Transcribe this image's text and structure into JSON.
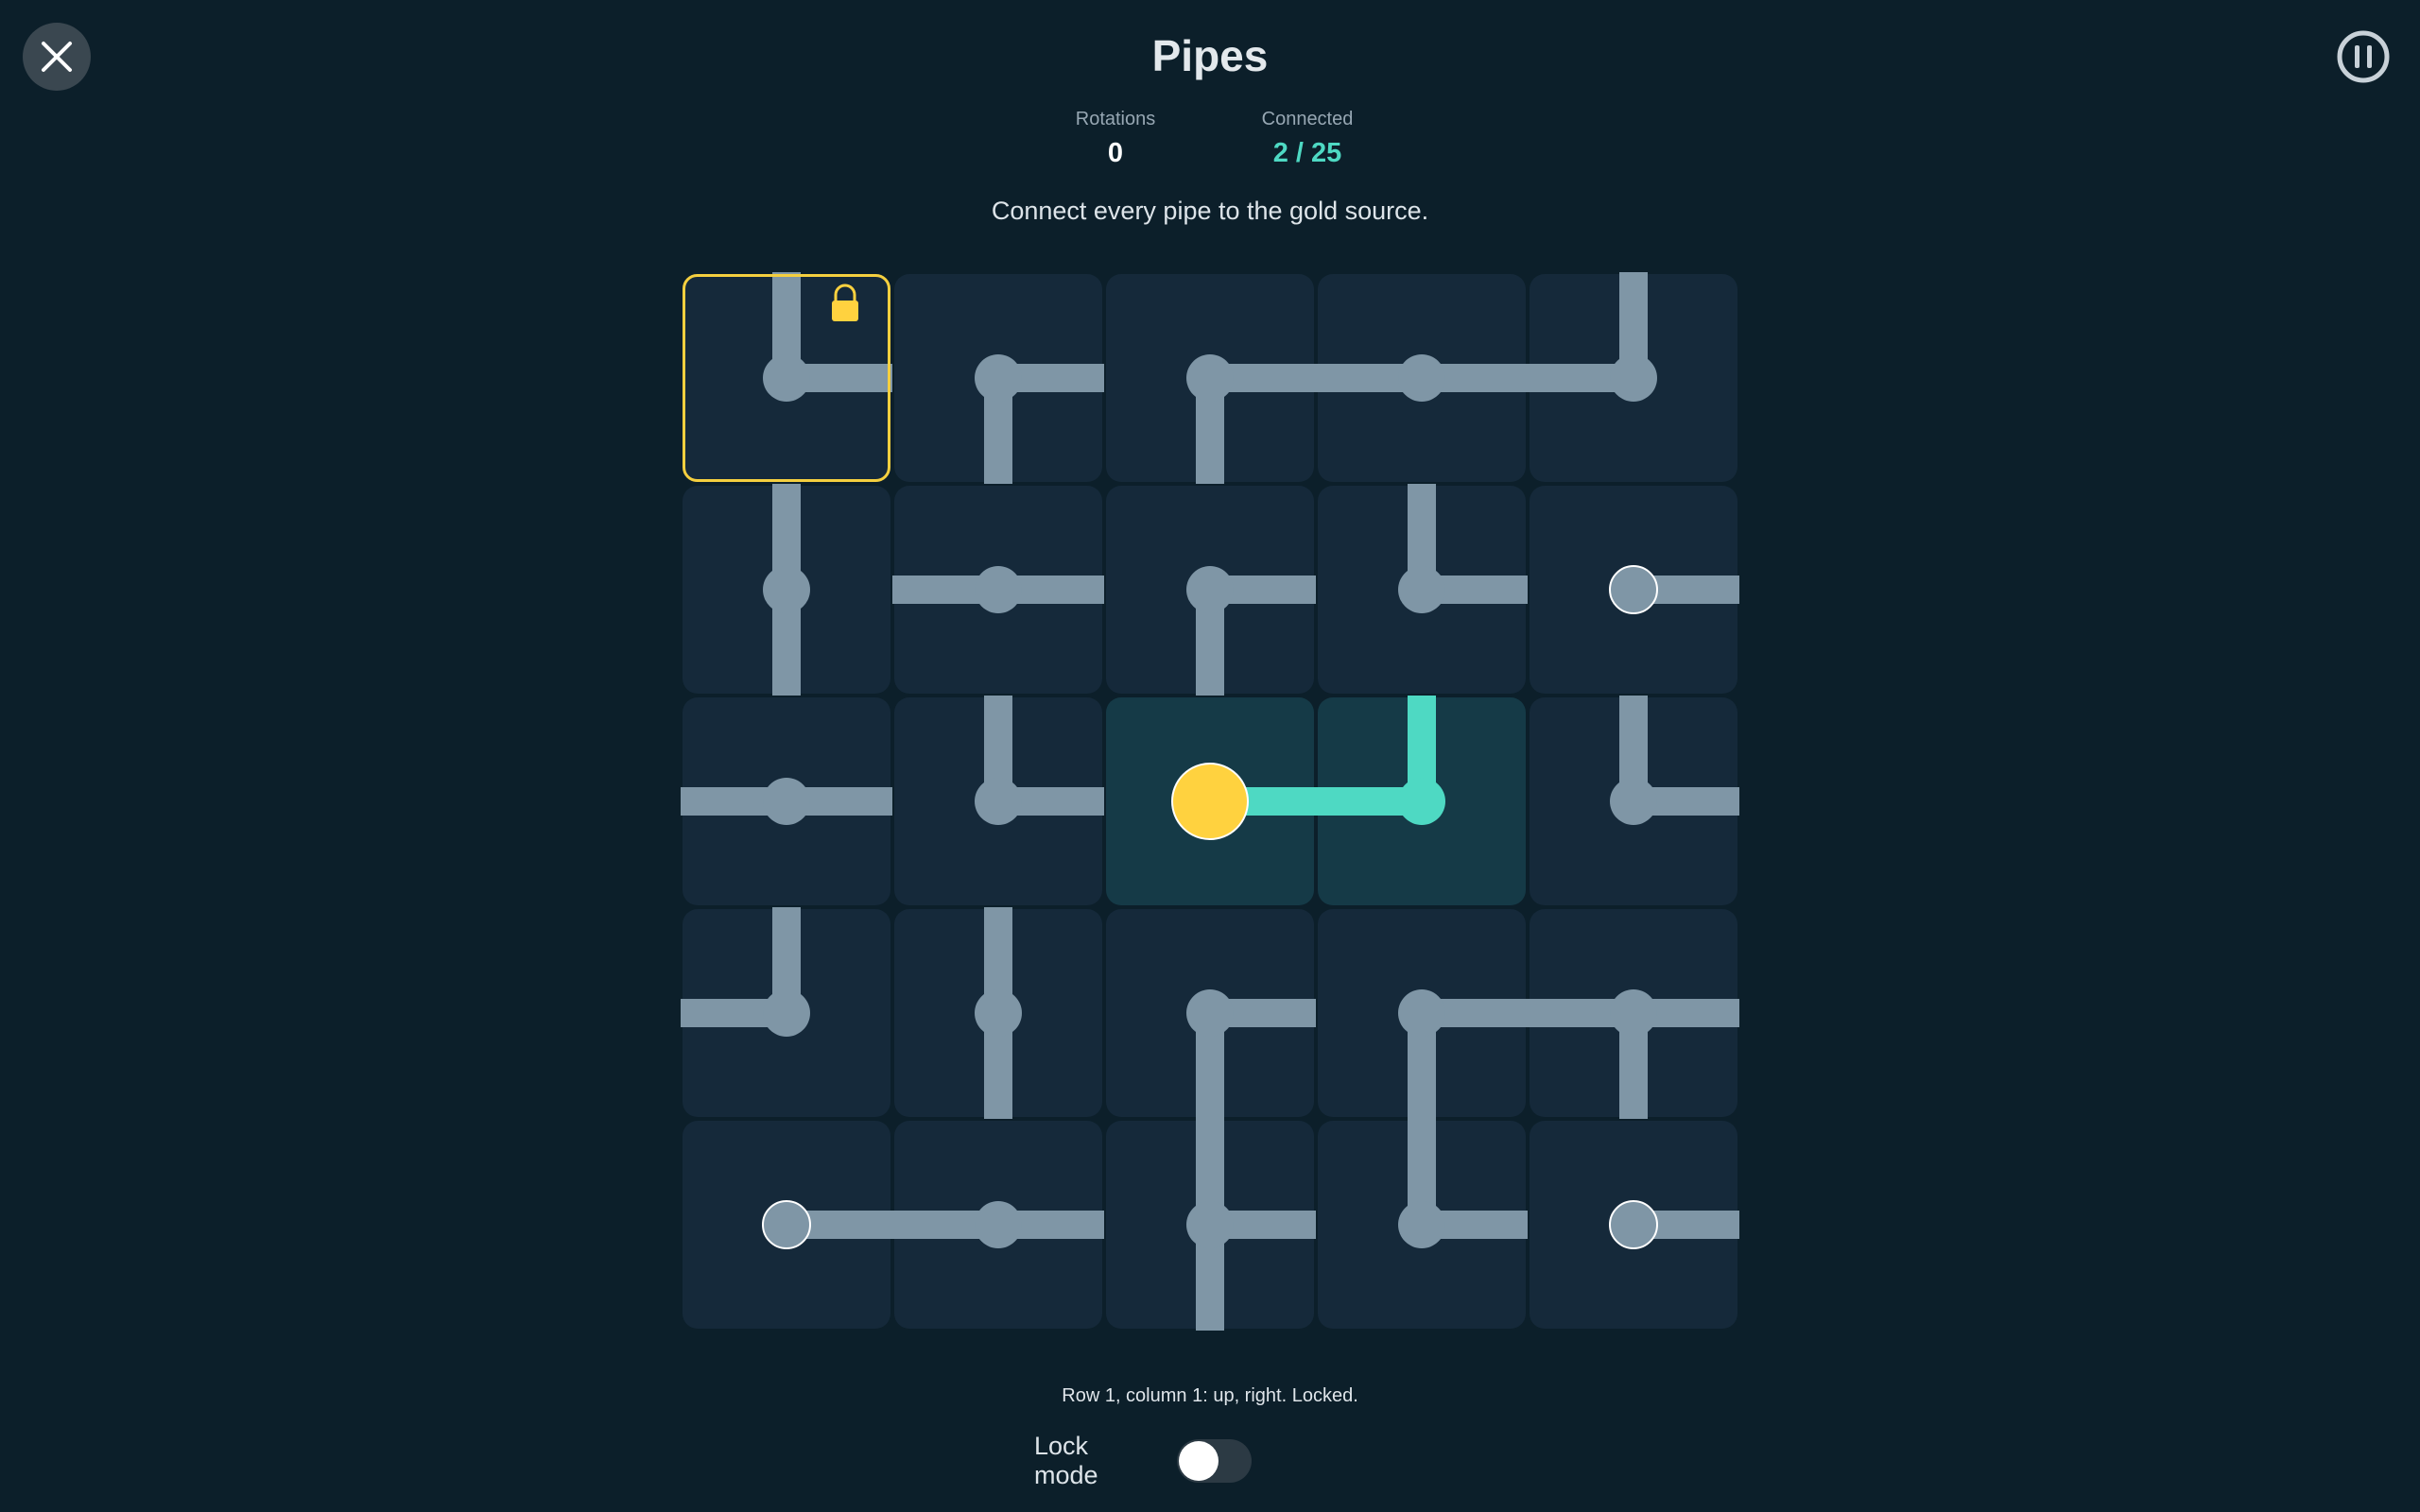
{
  "header": {
    "title": "Pipes",
    "close_icon": "close-icon",
    "pause_icon": "pause-icon"
  },
  "stats": {
    "rotations_label": "Rotations",
    "rotations_value": "0",
    "connected_label": "Connected",
    "connected_value": "2 / 25"
  },
  "instructions": "Connect every pipe to the gold source.",
  "status_line": "Row 1, column 1: up, right. Locked.",
  "lock_mode": {
    "label": "Lock mode",
    "enabled": false
  },
  "colors": {
    "background": "#0c1f2a",
    "tile": "#15293a",
    "tile_connected": "#153a47",
    "pipe": "#7f96a6",
    "pipe_connected": "#4ed9c3",
    "source": "#ffd23f",
    "selection": "#f5cf3f"
  },
  "grid": {
    "rows": 5,
    "cols": 5,
    "selected": [
      0,
      0
    ],
    "tiles": [
      [
        {
          "dirs": [
            "up",
            "right"
          ],
          "locked": true,
          "connected": false,
          "source": false,
          "endpoint": false
        },
        {
          "dirs": [
            "right",
            "down"
          ],
          "locked": false,
          "connected": false,
          "source": false,
          "endpoint": false
        },
        {
          "dirs": [
            "right",
            "down"
          ],
          "locked": false,
          "connected": false,
          "source": false,
          "endpoint": false
        },
        {
          "dirs": [
            "left",
            "right"
          ],
          "locked": false,
          "connected": false,
          "source": false,
          "endpoint": false
        },
        {
          "dirs": [
            "up",
            "left"
          ],
          "locked": false,
          "connected": false,
          "source": false,
          "endpoint": false
        }
      ],
      [
        {
          "dirs": [
            "up",
            "down"
          ],
          "locked": false,
          "connected": false,
          "source": false,
          "endpoint": false
        },
        {
          "dirs": [
            "left",
            "right"
          ],
          "locked": false,
          "connected": false,
          "source": false,
          "endpoint": false
        },
        {
          "dirs": [
            "right",
            "down"
          ],
          "locked": false,
          "connected": false,
          "source": false,
          "endpoint": false
        },
        {
          "dirs": [
            "up",
            "right"
          ],
          "locked": false,
          "connected": false,
          "source": false,
          "endpoint": false
        },
        {
          "dirs": [
            "right"
          ],
          "locked": false,
          "connected": false,
          "source": false,
          "endpoint": true
        }
      ],
      [
        {
          "dirs": [
            "left",
            "right"
          ],
          "locked": false,
          "connected": false,
          "source": false,
          "endpoint": false
        },
        {
          "dirs": [
            "up",
            "right"
          ],
          "locked": false,
          "connected": false,
          "source": false,
          "endpoint": false
        },
        {
          "dirs": [
            "right"
          ],
          "locked": false,
          "connected": true,
          "source": true,
          "endpoint": false
        },
        {
          "dirs": [
            "up",
            "left"
          ],
          "locked": false,
          "connected": true,
          "source": false,
          "endpoint": false
        },
        {
          "dirs": [
            "up",
            "right"
          ],
          "locked": false,
          "connected": false,
          "source": false,
          "endpoint": false
        }
      ],
      [
        {
          "dirs": [
            "up",
            "left"
          ],
          "locked": false,
          "connected": false,
          "source": false,
          "endpoint": false
        },
        {
          "dirs": [
            "up",
            "down"
          ],
          "locked": false,
          "connected": false,
          "source": false,
          "endpoint": false
        },
        {
          "dirs": [
            "right",
            "down"
          ],
          "locked": false,
          "connected": false,
          "source": false,
          "endpoint": false
        },
        {
          "dirs": [
            "right",
            "down"
          ],
          "locked": false,
          "connected": false,
          "source": false,
          "endpoint": false
        },
        {
          "dirs": [
            "left",
            "right",
            "down"
          ],
          "locked": false,
          "connected": false,
          "source": false,
          "endpoint": false
        }
      ],
      [
        {
          "dirs": [
            "right"
          ],
          "locked": false,
          "connected": false,
          "source": false,
          "endpoint": true
        },
        {
          "dirs": [
            "left",
            "right"
          ],
          "locked": false,
          "connected": false,
          "source": false,
          "endpoint": false
        },
        {
          "dirs": [
            "up",
            "right",
            "down"
          ],
          "locked": false,
          "connected": false,
          "source": false,
          "endpoint": false
        },
        {
          "dirs": [
            "up",
            "right"
          ],
          "locked": false,
          "connected": false,
          "source": false,
          "endpoint": false
        },
        {
          "dirs": [
            "right"
          ],
          "locked": false,
          "connected": false,
          "source": false,
          "endpoint": true
        }
      ]
    ]
  }
}
